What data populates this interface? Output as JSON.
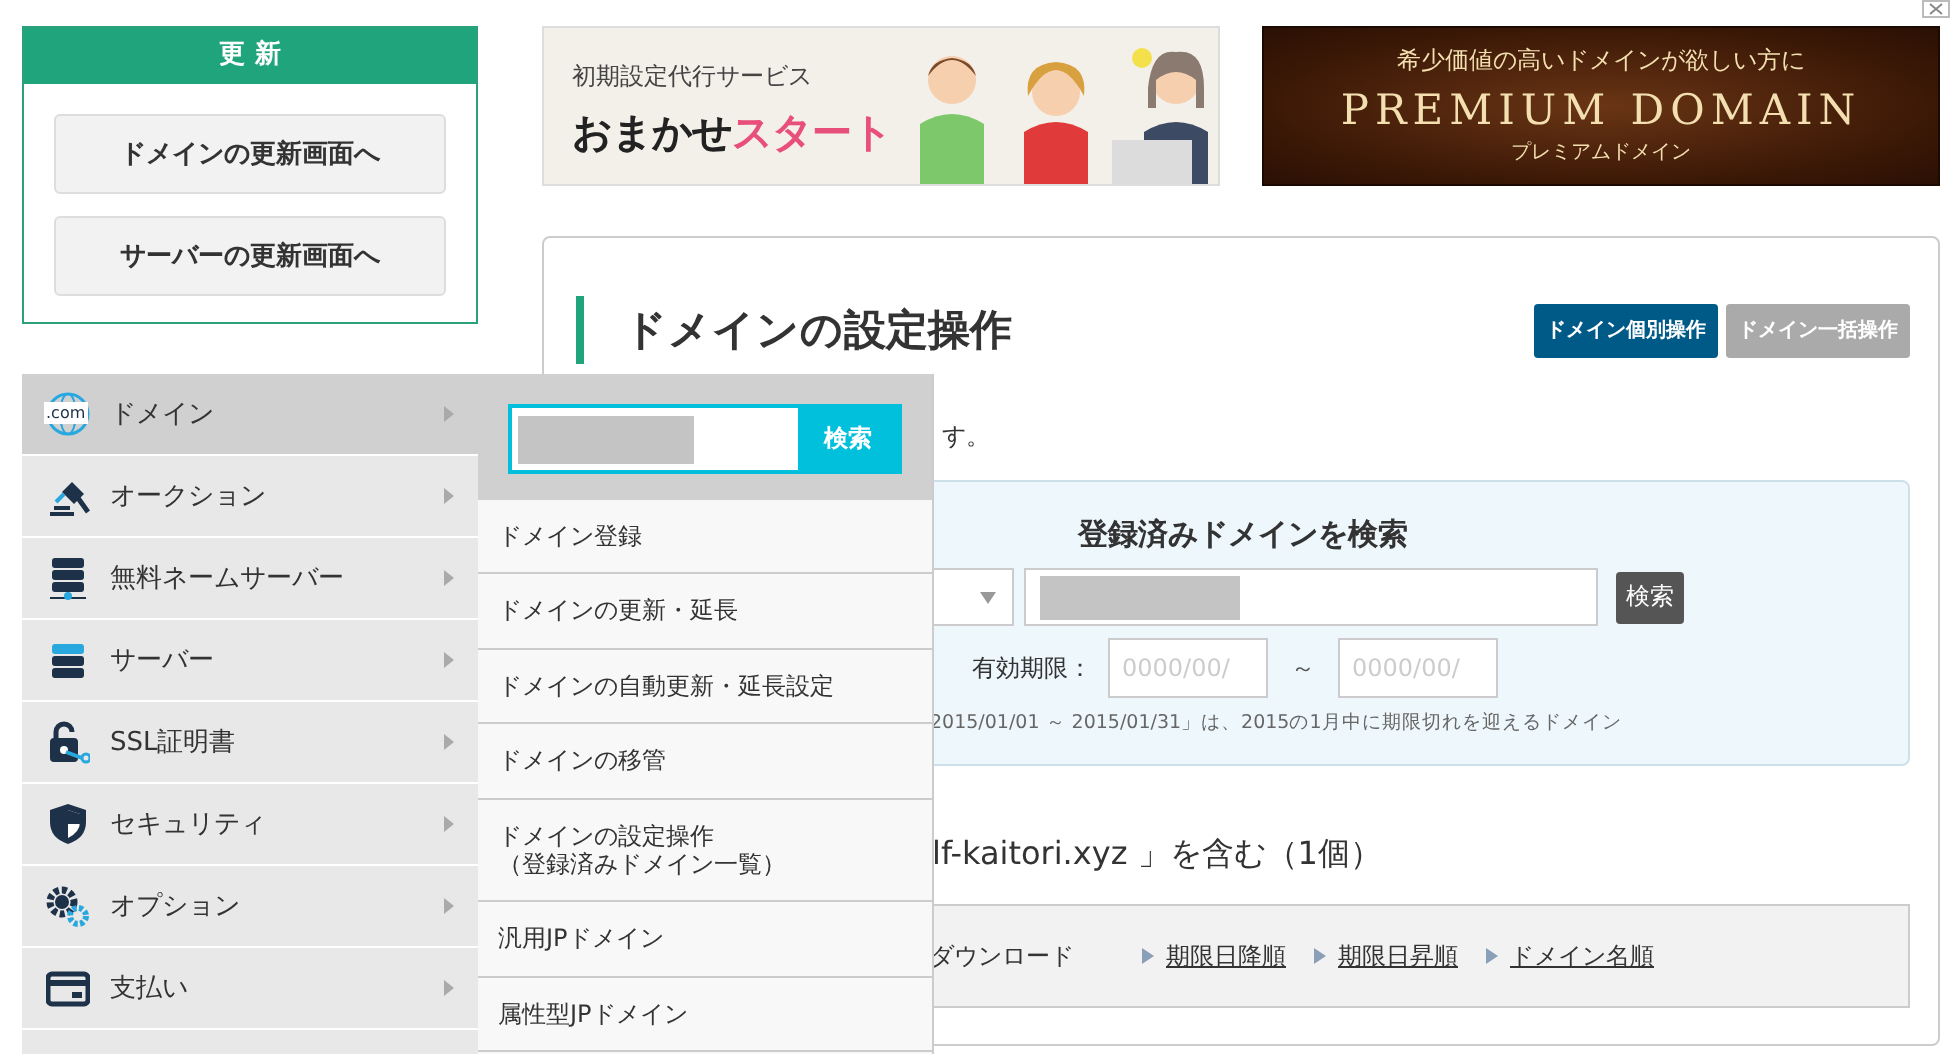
{
  "update_box": {
    "title": "更 新",
    "buttons": [
      "ドメインの更新画面へ",
      "サーバーの更新画面へ"
    ]
  },
  "banners": [
    {
      "kind": "service",
      "subtitle": "初期設定代行サービス",
      "title": "おまかせ",
      "title_accent": "スタート"
    },
    {
      "kind": "premium",
      "subtitle": "希少価値の高いドメインが欲しい方に",
      "title": "PREMIUM DOMAIN",
      "caption": "プレミアムドメイン"
    }
  ],
  "panel": {
    "title": "ドメインの設定操作",
    "mode_buttons": [
      {
        "label": "ドメイン個別操作",
        "selected": true
      },
      {
        "label": "ドメイン一括操作",
        "selected": false
      }
    ],
    "lead": "す。",
    "search": {
      "title": "登録済みドメインを検索",
      "button": "検索",
      "expiry_label": "有効期限：",
      "date_from": {
        "placeholder": "0000/00/"
      },
      "separator": "～",
      "date_to": {
        "placeholder": "0000/00/"
      },
      "note": "2015/01/01 ～ 2015/01/31」は、2015の1月中に期限切れを迎えるドメイン"
    },
    "result": "lf-kaitori.xyz 」を含む（1個）",
    "toolbar": {
      "download": "ダウンロード",
      "sort_links": [
        "期限日降順",
        "期限日昇順",
        "ドメイン名順"
      ]
    }
  },
  "menu": {
    "items": [
      {
        "label": "ドメイン",
        "icon_text": ".com",
        "selected": true
      },
      {
        "label": "オークション",
        "selected": false
      },
      {
        "label": "無料ネームサーバー",
        "selected": false
      },
      {
        "label": "サーバー",
        "selected": false
      },
      {
        "label": "SSL証明書",
        "selected": false
      },
      {
        "label": "セキュリティ",
        "selected": false
      },
      {
        "label": "オプション",
        "selected": false
      },
      {
        "label": "支払い",
        "selected": false
      }
    ],
    "submenu": {
      "search_button": "検索",
      "items": [
        {
          "lines": [
            "ドメイン登録"
          ]
        },
        {
          "lines": [
            "ドメインの更新・延長"
          ]
        },
        {
          "lines": [
            "ドメインの自動更新・延長設定"
          ]
        },
        {
          "lines": [
            "ドメインの移管"
          ]
        },
        {
          "lines": [
            "ドメインの設定操作",
            "（登録済みドメイン一覧）"
          ]
        },
        {
          "lines": [
            "汎用JPドメイン"
          ]
        },
        {
          "lines": [
            "属性型JPドメイン"
          ]
        }
      ]
    }
  }
}
